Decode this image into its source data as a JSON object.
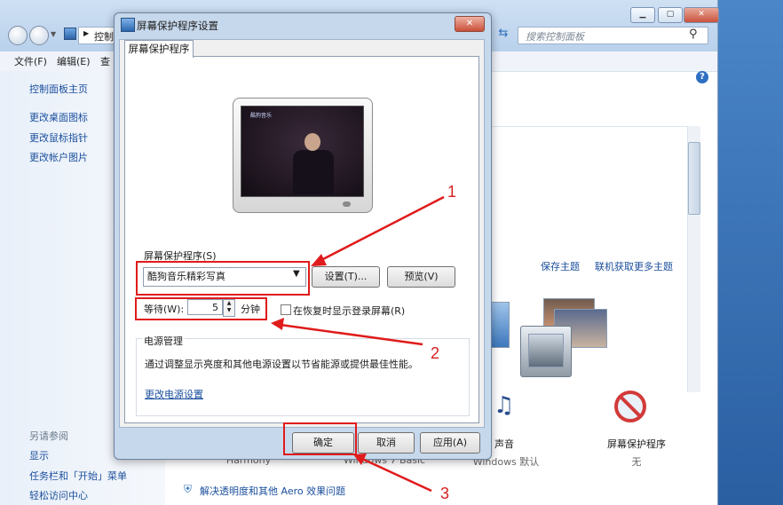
{
  "control_panel": {
    "address_text": "控制",
    "search_placeholder": "搜索控制面板",
    "menu": [
      "文件(F)",
      "编辑(E)",
      "查"
    ],
    "sidebar_links": [
      "控制面板主页",
      "更改桌面图标",
      "更改鼠标指针",
      "更改帐户图片"
    ],
    "see_also_title": "另请参阅",
    "see_also_links": [
      "显示",
      "任务栏和「开始」菜单",
      "轻松访问中心"
    ],
    "save_theme": "保存主题",
    "online_themes": "联机获取更多主题",
    "theme_caption_1": "Harmony",
    "theme_caption_2": "Windows 7 Basic",
    "sound_label": "声音",
    "sound_value": "Windows 默认",
    "screensaver_label": "屏幕保护程序",
    "screensaver_value": "无",
    "aero_link": "解决透明度和其他 Aero 效果问题"
  },
  "dialog": {
    "title": "屏幕保护程序设置",
    "tab": "屏幕保护程序",
    "preview_logo": "酷狗音乐",
    "screensaver_group_label": "屏幕保护程序(S)",
    "selected_screensaver": "酷狗音乐精彩写真",
    "settings_button": "设置(T)...",
    "preview_button": "预览(V)",
    "wait_label": "等待(W):",
    "wait_value": "5",
    "wait_unit": "分钟",
    "resume_label": "在恢复时显示登录屏幕(R)",
    "resume_checked": false,
    "power_group_label": "电源管理",
    "power_desc": "通过调整显示亮度和其他电源设置以节省能源或提供最佳性能。",
    "power_link": "更改电源设置",
    "ok_button": "确定",
    "cancel_button": "取消",
    "apply_button": "应用(A)"
  },
  "annotations": {
    "label_1": "1",
    "label_2": "2",
    "label_3": "3",
    "color": "#e01b1b"
  }
}
